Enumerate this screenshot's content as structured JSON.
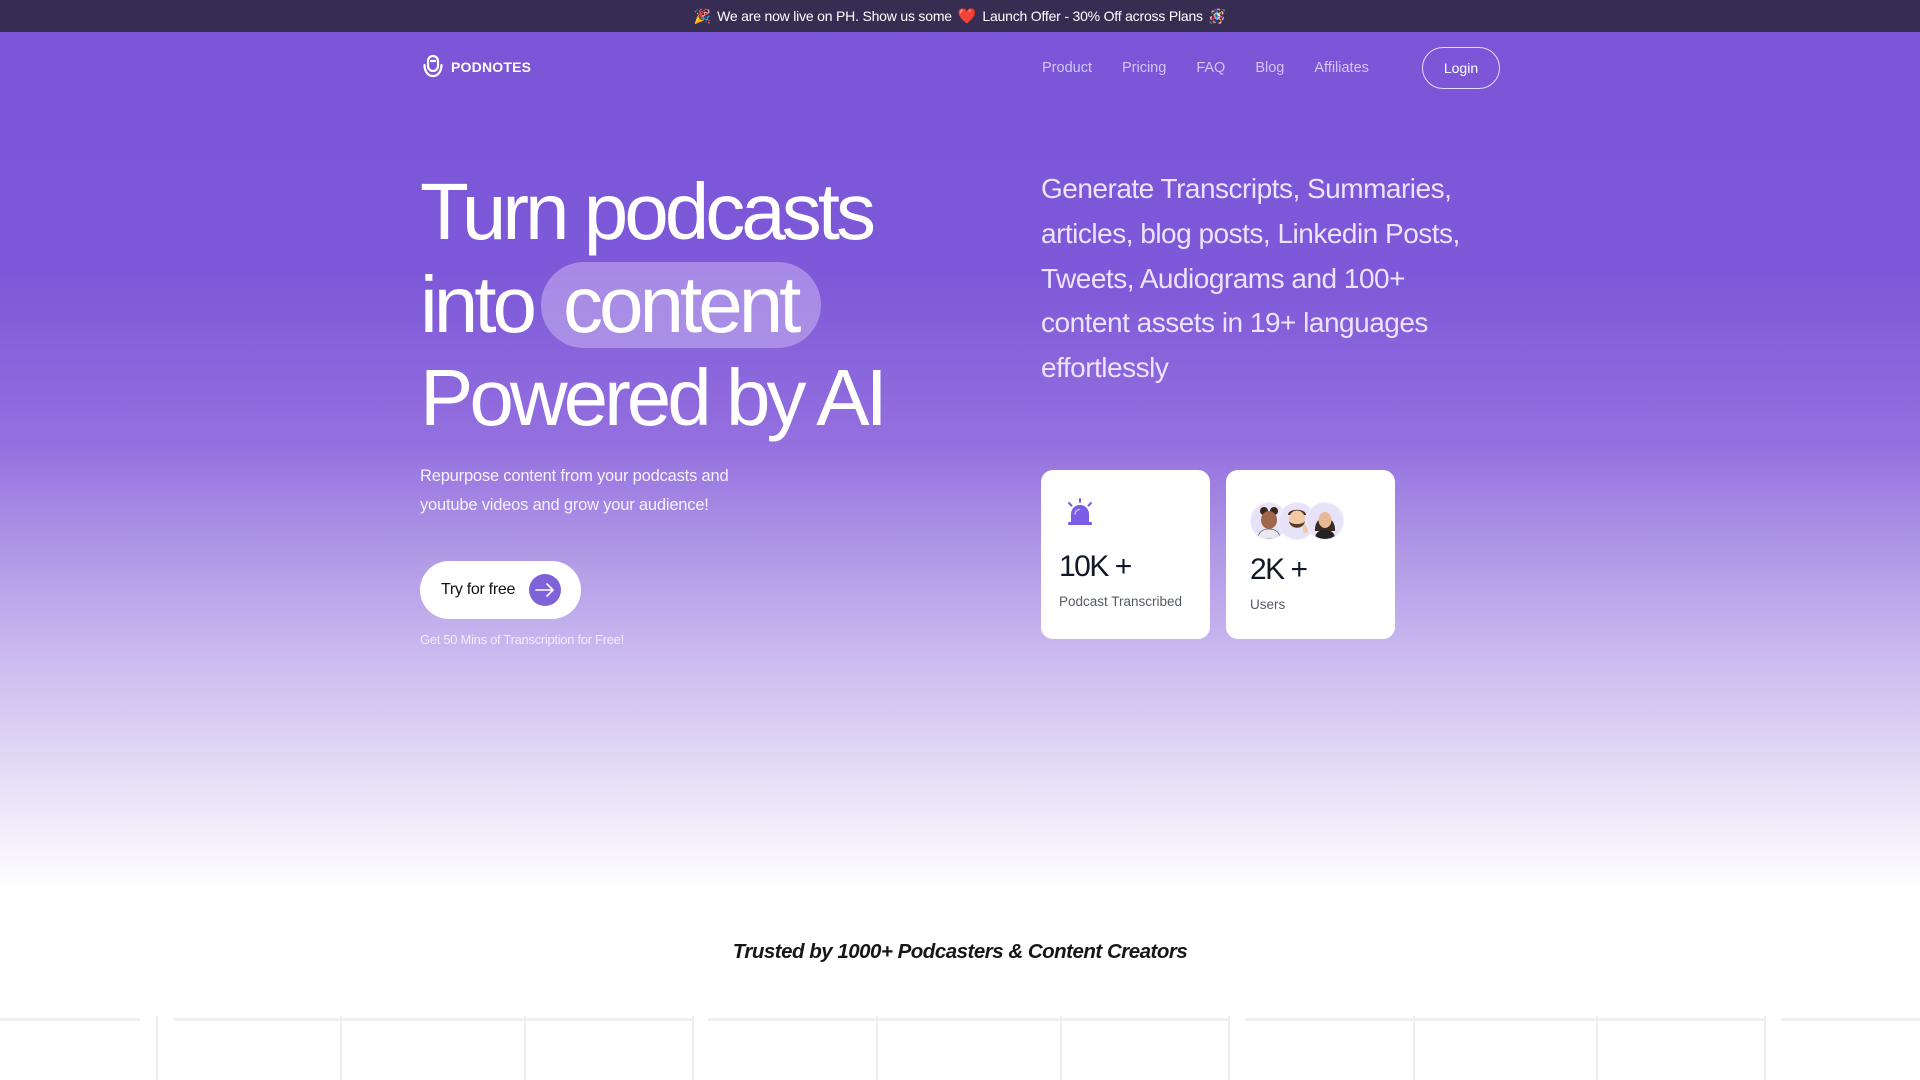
{
  "announcement": {
    "leading_emoji": "🎉",
    "text_before_heart": "We are now live on PH. Show us some",
    "heart_emoji": "❤️",
    "text_after_heart": "Launch Offer - 30% Off across Plans",
    "trailing_emoji": "🪅"
  },
  "nav": {
    "brand": "PODNOTES",
    "logo_icon": "microphone-icon",
    "links": [
      {
        "label": "Product"
      },
      {
        "label": "Pricing"
      },
      {
        "label": "FAQ"
      },
      {
        "label": "Blog"
      },
      {
        "label": "Affiliates"
      }
    ],
    "login_label": "Login"
  },
  "hero": {
    "headline": {
      "line1": "Turn podcasts",
      "line2_prefix": "into",
      "line2_highlight": "content",
      "line3": "Powered by AI"
    },
    "subtitle": "Repurpose content from your podcasts and youtube videos and grow your audience!",
    "cta_label": "Try for free",
    "cta_icon": "arrow-right-icon",
    "cta_note": "Get 50 Mins of Transcription for Free!",
    "features_text": "Generate Transcripts, Summaries, articles, blog posts, Linkedin Posts, Tweets, Audiograms and 100+ content assets in 19+ languages effortlessly",
    "stats": [
      {
        "icon": "siren-icon",
        "value": "10K +",
        "label": "Podcast Transcribed"
      },
      {
        "icon": "avatars-group",
        "value": "2K +",
        "label": "Users"
      }
    ]
  },
  "trusted": {
    "title": "Trusted by 1000+ Podcasters & Content Creators"
  },
  "colors": {
    "announcement_bg": "#372d52",
    "hero_purple": "#7b55d7",
    "accent": "#7e62d9",
    "stat_icon": "#7b5ce6"
  }
}
